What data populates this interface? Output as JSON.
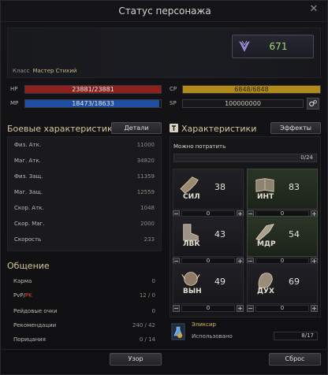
{
  "window": {
    "title": "Статус персонажа",
    "close": "✕"
  },
  "character": {
    "class_label": "Класс",
    "class_value": "Мастер Стихий",
    "cp_value": "671"
  },
  "bars": {
    "hp": {
      "label": "HP",
      "text": "23881/23881",
      "fill": 1.0,
      "color": "#8d1f1f"
    },
    "mp": {
      "label": "MP",
      "text": "18473/18633",
      "fill": 0.991,
      "color": "#1e4fa3"
    },
    "cp": {
      "label": "CP",
      "text": "6848/6848",
      "fill": 1.0,
      "color": "#b28a1a"
    },
    "sp": {
      "label": "SP",
      "text": "100000000"
    }
  },
  "combat": {
    "title": "Боевые характеристики",
    "details_button": "Детали",
    "rows": [
      {
        "label": "Физ. Атк.",
        "value": "11000"
      },
      {
        "label": "Маг. Атк.",
        "value": "34820"
      },
      {
        "label": "Физ. Защ.",
        "value": "11359"
      },
      {
        "label": "Маг. Защ.",
        "value": "12559"
      },
      {
        "label": "Скор. Атк.",
        "value": "1048"
      },
      {
        "label": "Скор. Маг.",
        "value": "2000"
      },
      {
        "label": "Скорость",
        "value": "233"
      }
    ]
  },
  "social": {
    "title": "Общение",
    "rows": [
      {
        "label": "Карма",
        "value": "0"
      },
      {
        "label": "PvP/",
        "label_pk": "PK",
        "value": "12 / 0"
      },
      {
        "label": "Рейдовые очки",
        "value": "0"
      },
      {
        "label": "Рекомендации",
        "value": "240 / 42"
      },
      {
        "label": "Порицания",
        "value": "0 / 14"
      }
    ]
  },
  "stats": {
    "title": "Характеристики",
    "effects_button": "Эффекты",
    "can_spend_label": "Можно потратить",
    "can_spend_value": "0/24",
    "cells": [
      {
        "abbr": "СИЛ",
        "value": "38",
        "input": "0",
        "icon": "strength-icon"
      },
      {
        "abbr": "ИНТ",
        "value": "83",
        "input": "0",
        "icon": "intelligence-icon"
      },
      {
        "abbr": "ЛВК",
        "value": "43",
        "input": "0",
        "icon": "dexterity-icon"
      },
      {
        "abbr": "МДР",
        "value": "54",
        "input": "0",
        "icon": "wisdom-icon"
      },
      {
        "abbr": "ВЫН",
        "value": "49",
        "input": "0",
        "icon": "constitution-icon"
      },
      {
        "abbr": "ДУХ",
        "value": "69",
        "input": "0",
        "icon": "spirit-icon"
      }
    ]
  },
  "elixir": {
    "name": "Эликсир",
    "used_label": "Использовано",
    "count": "8/17"
  },
  "footer": {
    "pattern_button": "Узор",
    "reset_button": "Сброс"
  },
  "stepper": {
    "minus": "−",
    "plus": "+"
  }
}
